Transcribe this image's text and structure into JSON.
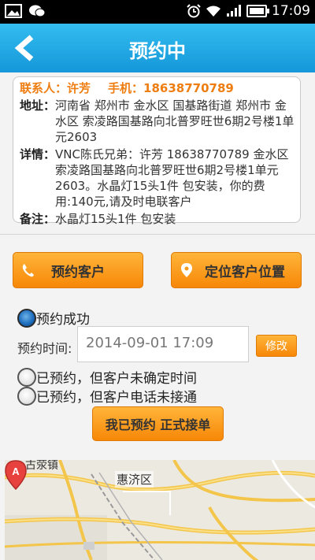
{
  "status": {
    "time": "17:09"
  },
  "header": {
    "title": "预约中"
  },
  "info": {
    "contact_label": "联系人：",
    "contact_name": "许芳",
    "phone_label": "手机：",
    "phone": "18638770789",
    "address_label": "地址：",
    "address": "河南省 郑州市 金水区 国基路街道 郑州市 金水区 索凌路国基路向北普罗旺世6期2号楼1单元2603",
    "detail_label": "详情：",
    "detail": "VNC陈氏兄弟：许芳 18638770789 金水区索凌路国基路向北普罗旺世6期2号楼1单元2603。水晶灯15头1件 包安装，你的费用:140元,请及时电联客户",
    "note_label": "备注：",
    "note": "水晶灯15头1件 包安装"
  },
  "actions": {
    "appoint_label": "预约客户",
    "locate_label": "定位客户位置"
  },
  "options": {
    "success_label": "预约成功",
    "time_label": "预约时间:",
    "time_value": "2014-09-01 17:09",
    "edit_label": "修改",
    "unconfirmed_label": "已预约，但客户未确定时间",
    "no_answer_label": "已预约，但客户电话未接通",
    "accept_label": "我已预约 正式接单"
  },
  "map": {
    "district": "惠济区",
    "town": "古荥镇",
    "marker_letter": "A"
  }
}
